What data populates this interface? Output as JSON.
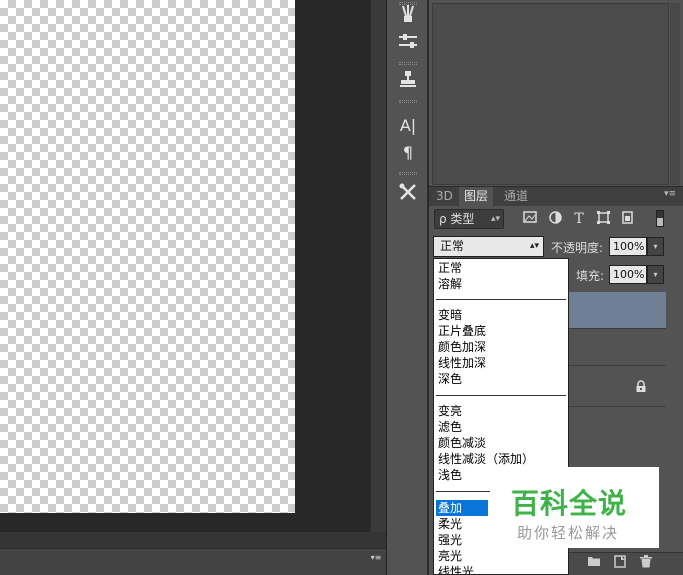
{
  "layers_panel": {
    "tabs": [
      "3D",
      "图层",
      "通道"
    ],
    "active_tab": 1,
    "filter_label": "ρ 类型",
    "blend_mode": "正常",
    "opacity_label": "不透明度:",
    "opacity_value": "100%",
    "fill_label": "填充:",
    "fill_value": "100%"
  },
  "blend_menu": {
    "groups": [
      [
        "正常",
        "溶解"
      ],
      [
        "变暗",
        "正片叠底",
        "颜色加深",
        "线性加深",
        "深色"
      ],
      [
        "变亮",
        "滤色",
        "颜色减淡",
        "线性减淡（添加）",
        "浅色"
      ],
      [
        "叠加",
        "柔光",
        "强光",
        "亮光",
        "线性光"
      ]
    ],
    "highlighted": "叠加"
  },
  "watermark": {
    "title": "百科全说",
    "subtitle": "助你轻松解决"
  },
  "colors": {
    "selection": "#0a75d8",
    "selected_layer": "#6e7f96",
    "watermark_green": "#3fb34a"
  },
  "icons": {
    "toolstrip": [
      "brush-presets-icon",
      "adjustments-icon",
      "clone-source-icon",
      "character-icon",
      "paragraph-icon",
      "tools-icon"
    ],
    "filters": [
      "image-filter-icon",
      "adjustment-filter-icon",
      "type-filter-icon",
      "shape-filter-icon",
      "smart-object-filter-icon"
    ],
    "layer_actions": [
      "new-group-icon",
      "new-layer-icon",
      "delete-layer-icon"
    ]
  }
}
